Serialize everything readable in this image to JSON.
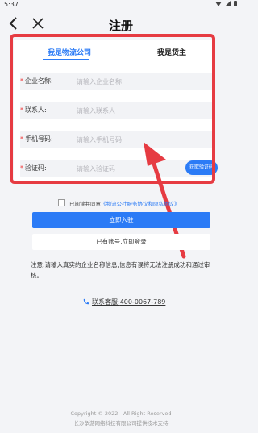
{
  "status_bar": {
    "time": "5:37"
  },
  "header": {
    "title": "注册"
  },
  "tabs": [
    {
      "label": "我是物流公司",
      "active": true
    },
    {
      "label": "我是货主",
      "active": false
    }
  ],
  "form": {
    "required_mark": "*",
    "fields": [
      {
        "label": "企业名称:",
        "placeholder": "请输入企业名称",
        "value": ""
      },
      {
        "label": "联系人:",
        "placeholder": "请输入联系人",
        "value": ""
      },
      {
        "label": "手机号码:",
        "placeholder": "请输入手机号码",
        "value": ""
      },
      {
        "label": "验证码:",
        "placeholder": "请输入验证码",
        "value": ""
      }
    ],
    "code_button": "获取验证码"
  },
  "agreement": {
    "prefix": "已阅读并同意",
    "link": "《物流公社服务协议和隐私协议》"
  },
  "buttons": {
    "register": "立即入驻",
    "login": "已有账号,立即登录"
  },
  "notice": "注意:请输入真实的企业名称信息,信息有误将无法注册成功和通过审核。",
  "service": {
    "label": "联系客服:",
    "phone": "400-0067-789"
  },
  "footer": {
    "copyright": "Copyright © 2022 - All Right Reserved",
    "support": "长沙争游网络科技有限公司提供技术支持"
  },
  "colors": {
    "accent": "#2b7bf6",
    "annotation": "#e63b42",
    "required": "#e33"
  }
}
